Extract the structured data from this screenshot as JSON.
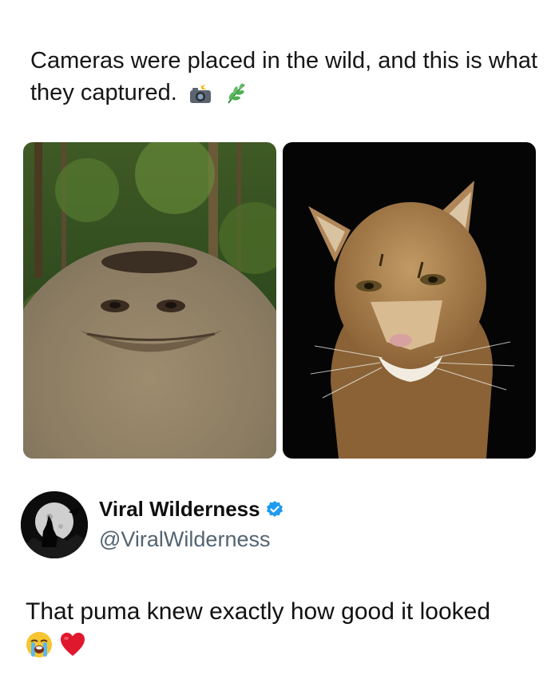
{
  "post": {
    "caption": "Cameras were placed in the wild, and this is what they captured.",
    "caption_emojis": [
      "camera-flash-icon",
      "herb-icon"
    ]
  },
  "photos": [
    {
      "subject": "monkey-selfie-photo"
    },
    {
      "subject": "puma-night-photo"
    }
  ],
  "tweet": {
    "display_name": "Viral Wilderness",
    "handle": "@ViralWilderness",
    "verified": true,
    "text": "That puma knew exactly how good it looked",
    "text_emojis": [
      "loudly-crying-face-icon",
      "red-heart-icon"
    ]
  },
  "colors": {
    "verified_blue": "#1d9bf0",
    "handle_gray": "#536471",
    "heart_red": "#e0182d"
  }
}
